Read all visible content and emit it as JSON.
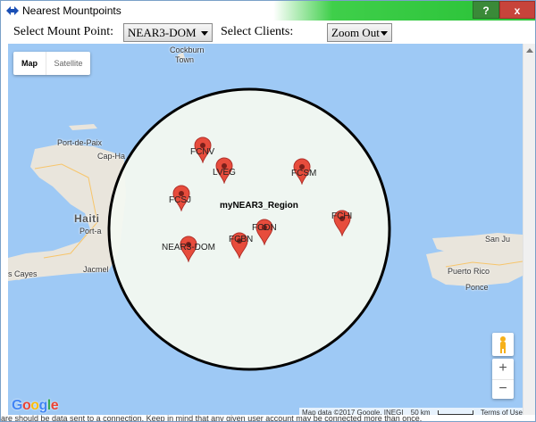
{
  "window": {
    "title": "Nearest Mountpoints"
  },
  "titlebar_buttons": {
    "help": "?",
    "close": "x"
  },
  "toolbar": {
    "mount_label": "Select Mount Point:",
    "mount_value": "NEAR3-DOM",
    "clients_label": "Select Clients:",
    "clients_value": "Zoom Out"
  },
  "map": {
    "type_control": {
      "map": "Map",
      "satellite": "Satellite"
    },
    "places": {
      "cockburn": "Cockburn",
      "town": "Town",
      "port_de_paix": "Port-de-Paix",
      "cap_haitien": "Cap-Ha",
      "haiti": "Haiti",
      "port_au": "Port-a",
      "jacmel": "Jacmel",
      "les_cayes": "s Cayes",
      "san_juan": "San Ju",
      "puerto_rico": "Puerto Rico",
      "ponce": "Ponce"
    },
    "region_label": "myNEAR3_Region",
    "markers": [
      {
        "id": "FCNV",
        "label": "FCNV"
      },
      {
        "id": "LVEG",
        "label": "LVEG"
      },
      {
        "id": "FCSM",
        "label": "FCSM"
      },
      {
        "id": "FCSJ",
        "label": "FCSJ"
      },
      {
        "id": "FCDN",
        "label": "FCDN"
      },
      {
        "id": "FCHI",
        "label": "FCHI"
      },
      {
        "id": "FCBN",
        "label": "FCBN"
      },
      {
        "id": "NEAR3-DOM",
        "label": "NEAR3-DOM"
      }
    ],
    "zoom_in": "+",
    "zoom_out": "−",
    "attribution": {
      "data": "Map data ©2017 Google, INEGI",
      "scale": "50 km",
      "terms": "Terms of Use"
    },
    "colors": {
      "water": "#9ec9f5",
      "land": "#e9e5dc",
      "circle_fill": "#f3f8f0",
      "marker": "#e74c3c"
    }
  },
  "google_logo": {
    "g1": "G",
    "o1": "o",
    "o2": "o",
    "g2": "g",
    "l": "l",
    "e": "e"
  },
  "footer_text": "are should be data sent to a connection. Keep in mind that any given user account may be connected more than once."
}
